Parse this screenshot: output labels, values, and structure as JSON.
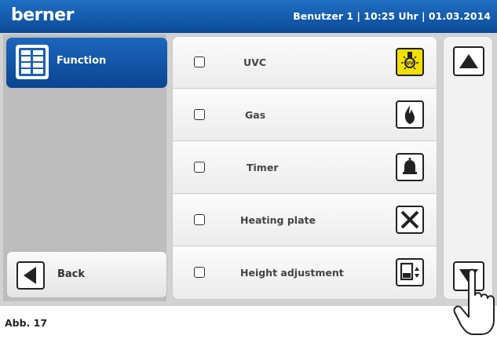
{
  "header": {
    "brand": "berner",
    "status": "Benutzer 1 | 10:25 Uhr | 01.03.2014"
  },
  "nav": {
    "function_label": "Function",
    "back_label": "Back"
  },
  "list": {
    "items": [
      {
        "label": "UVC",
        "icon": "uv-lamp-icon",
        "active": true
      },
      {
        "label": "Gas",
        "icon": "flame-icon",
        "active": false
      },
      {
        "label": "Timer",
        "icon": "bell-icon",
        "active": false
      },
      {
        "label": "Heating plate",
        "icon": "close-x-icon",
        "active": false
      },
      {
        "label": "Height adjustment",
        "icon": "height-adjust-icon",
        "active": false
      }
    ]
  },
  "scroll": {
    "up_icon": "arrow-up-icon",
    "down_icon": "arrow-down-icon"
  },
  "caption": "Abb. 17",
  "colors": {
    "header": "#0b4a96",
    "active_icon": "#f2df00"
  }
}
